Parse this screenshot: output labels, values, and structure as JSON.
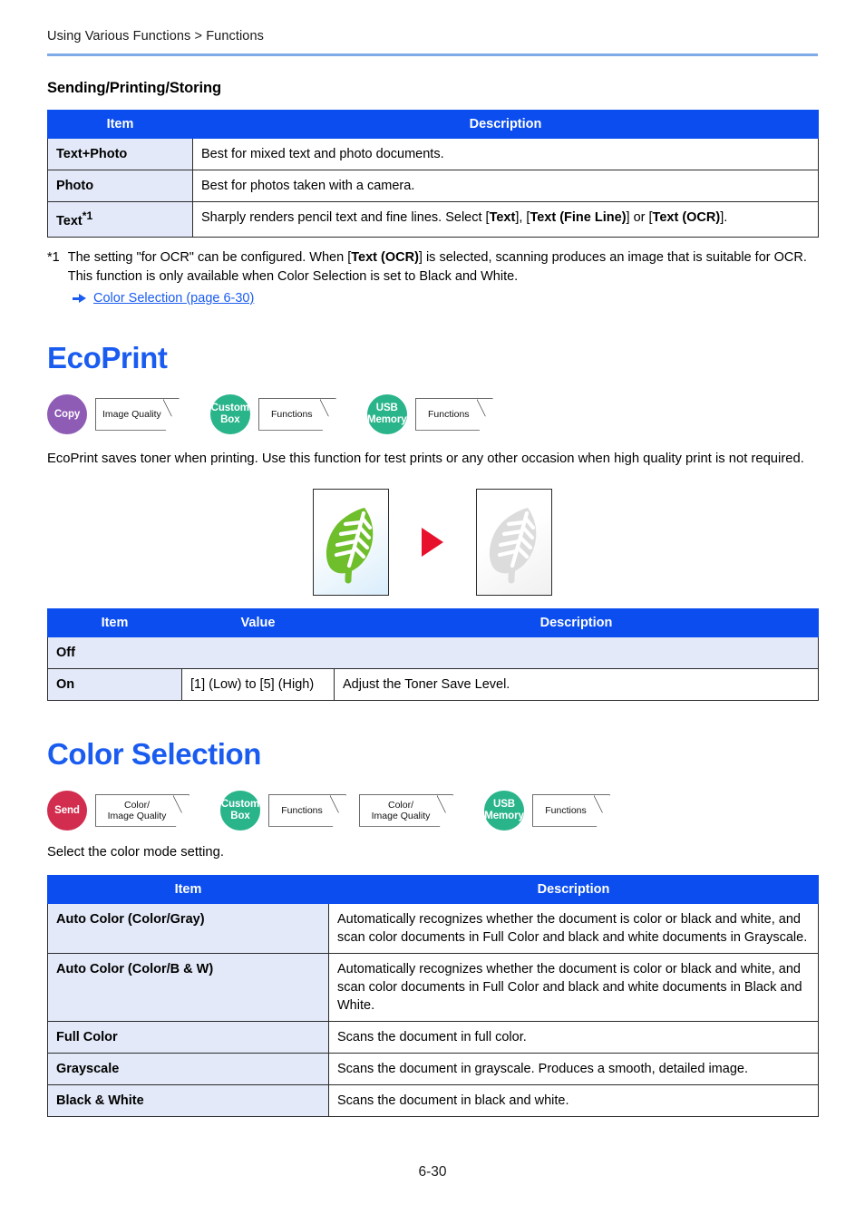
{
  "header": {
    "breadcrumb": "Using Various Functions > Functions"
  },
  "sections": {
    "sending_printing_storing": {
      "heading": "Sending/Printing/Storing",
      "table": {
        "columns": [
          "Item",
          "Description"
        ],
        "rows": [
          {
            "item": "Text+Photo",
            "item_sup": "",
            "description": "Best for mixed text and photo documents."
          },
          {
            "item": "Photo",
            "item_sup": "",
            "description": "Best for photos taken with a camera."
          },
          {
            "item": "Text",
            "item_sup": "*1",
            "description_parts": [
              {
                "text": "Sharply renders pencil text and fine lines. Select [",
                "bold": false
              },
              {
                "text": "Text",
                "bold": true
              },
              {
                "text": "], [",
                "bold": false
              },
              {
                "text": "Text (Fine Line)",
                "bold": true
              },
              {
                "text": "] or [",
                "bold": false
              },
              {
                "text": "Text (OCR)",
                "bold": true
              },
              {
                "text": "].",
                "bold": false
              }
            ]
          }
        ]
      },
      "footnote": {
        "mark": "*1",
        "parts": [
          {
            "text": "The setting \"for OCR\" can be configured. When [",
            "bold": false
          },
          {
            "text": "Text (OCR)",
            "bold": true
          },
          {
            "text": "] is selected, scanning produces an image that is suitable for OCR. This function is only available when Color Selection is set to Black and White.",
            "bold": false
          }
        ],
        "link": "Color Selection (page 6-30)",
        "link_icon": "arrow-right-icon"
      }
    },
    "ecoprint": {
      "heading": "EcoPrint",
      "badges": [
        {
          "circle_label": "Copy",
          "circle_color": "#8E5BB5",
          "tag_label": "Image Quality",
          "tag_lines": [
            "Image Quality"
          ]
        },
        {
          "circle_label": "Custom Box",
          "circle_color": "#29B48A",
          "tag_label": "Functions",
          "tag_lines": [
            "Functions"
          ]
        },
        {
          "circle_label": "USB Memory",
          "circle_color": "#29B48A",
          "tag_label": "Functions",
          "tag_lines": [
            "Functions"
          ]
        }
      ],
      "description": "EcoPrint saves toner when printing. Use this function for test prints or any other occasion when high quality print is not required.",
      "figure": {
        "left_image": "green-leaf-image",
        "arrow": "red-right-triangle-icon",
        "right_image": "gray-leaf-image"
      },
      "table": {
        "columns": [
          "Item",
          "Value",
          "Description"
        ],
        "rows": [
          {
            "item": "Off",
            "value": "",
            "description": "",
            "span": true
          },
          {
            "item": "On",
            "value": "[1] (Low) to [5] (High)",
            "description": "Adjust the Toner Save Level.",
            "span": false
          }
        ]
      }
    },
    "color_selection": {
      "heading": "Color Selection",
      "badges": [
        {
          "circle_label": "Send",
          "circle_color": "#D22D4E",
          "tag_lines": [
            "Color/",
            "Image Quality"
          ]
        },
        {
          "circle_label": "Custom Box",
          "circle_color": "#29B48A",
          "tag_lines": [
            "Functions"
          ]
        },
        {
          "circle_label": "",
          "circle_color": "",
          "tag_lines": [
            "Color/",
            "Image Quality"
          ]
        },
        {
          "circle_label": "USB Memory",
          "circle_color": "#29B48A",
          "tag_lines": [
            "Functions"
          ]
        }
      ],
      "description": "Select the color mode setting.",
      "table": {
        "columns": [
          "Item",
          "Description"
        ],
        "rows": [
          {
            "item": "Auto Color (Color/Gray)",
            "description": "Automatically recognizes whether the document is color or black and white, and scan color documents in Full Color and black and white documents in Grayscale."
          },
          {
            "item": "Auto Color (Color/B & W)",
            "description": "Automatically recognizes whether the document is color or black and white, and scan color documents in Full Color and black and white documents in Black and White."
          },
          {
            "item": "Full Color",
            "description": "Scans the document in full color."
          },
          {
            "item": "Grayscale",
            "description": "Scans the document in grayscale. Produces a smooth, detailed image."
          },
          {
            "item": "Black & White",
            "description": "Scans the document in black and white."
          }
        ]
      }
    }
  },
  "footer": {
    "page_number": "6-30"
  },
  "colors": {
    "table_header_blue": "#0B4DEE",
    "heading_blue": "#1A5CF0",
    "item_cell_bg": "#E3E9F8",
    "rule_blue": "#7FAAE8",
    "copy_purple": "#8E5BB5",
    "send_red": "#D22D4E",
    "box_green": "#29B48A",
    "arrow_red": "#E8112D"
  }
}
